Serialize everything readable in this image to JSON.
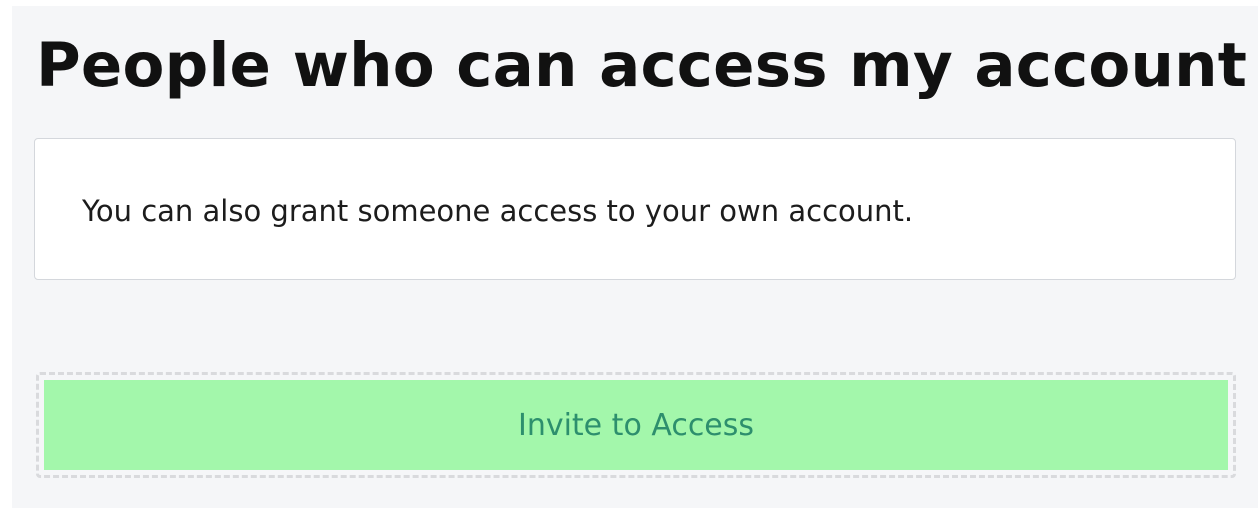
{
  "header": {
    "title": "People who can access my account"
  },
  "info_card": {
    "text": "You can also grant someone access to your own account."
  },
  "invite": {
    "button_label": "Invite to Access"
  },
  "colors": {
    "page_background": "#f5f6f8",
    "card_background": "#ffffff",
    "button_background": "#a3f7ab",
    "button_text": "#2d8f6d",
    "title_text": "#111111"
  }
}
